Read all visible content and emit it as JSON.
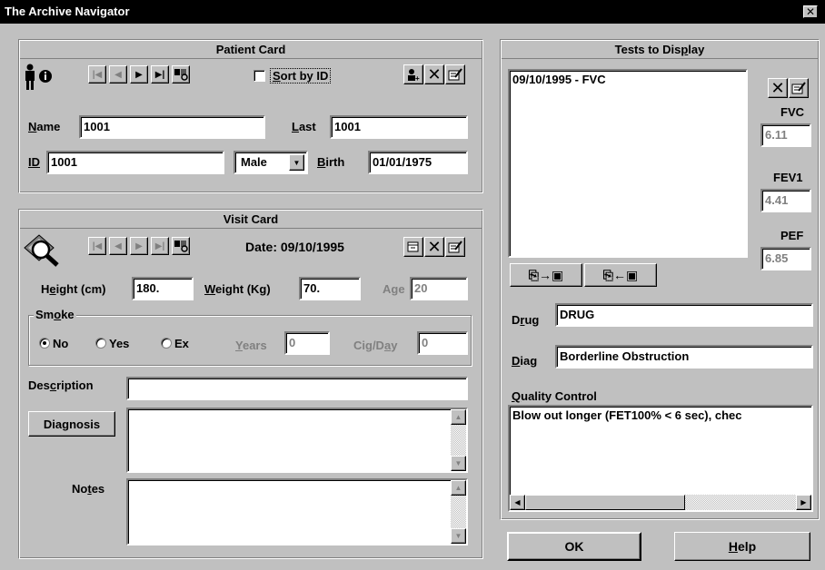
{
  "window": {
    "title": "The Archive Navigator",
    "close_glyph": "✕"
  },
  "patient": {
    "header": "Patient Card",
    "sort_by_id": {
      "label_pre": "",
      "hot": "S",
      "label_post": "ort by ID",
      "checked": false
    },
    "name": {
      "label_hot": "N",
      "label_rest": "ame",
      "value": "1001"
    },
    "last": {
      "label_hot": "L",
      "label_rest": "ast",
      "value": "1001"
    },
    "id": {
      "label_hot": "ID",
      "label_rest": "",
      "value": "1001"
    },
    "sex": {
      "value": "Male"
    },
    "birth": {
      "label_hot": "B",
      "label_rest": "irth",
      "value": "01/01/1975"
    }
  },
  "visit": {
    "header": "Visit Card",
    "date_label": "Date: 09/10/1995",
    "height": {
      "label_pre": "H",
      "hot": "e",
      "label_post": "ight (cm)",
      "value": "180."
    },
    "weight": {
      "label_pre": "",
      "hot": "W",
      "label_post": "eight (Kg)",
      "value": "70."
    },
    "age": {
      "label": "Age",
      "value": "20"
    },
    "smoke": {
      "title_pre": "Sm",
      "title_hot": "o",
      "title_post": "ke",
      "options": [
        "No",
        "Yes",
        "Ex"
      ],
      "selected": "No",
      "years": {
        "hot": "Y",
        "rest": "ears",
        "value": "0"
      },
      "cig_day": {
        "pre": "Cig/D",
        "hot": "a",
        "post": "y",
        "value": "0"
      }
    },
    "description": {
      "pre": "Des",
      "hot": "c",
      "post": "ription",
      "value": ""
    },
    "diagnosis_button": {
      "pre": "Dia",
      "hot": "g",
      "post": "nosis"
    },
    "diagnosis_value": "",
    "notes": {
      "pre": "No",
      "hot": "t",
      "post": "es",
      "value": ""
    }
  },
  "tests": {
    "header_pre": "Tests to Dis",
    "header_hot": "p",
    "header_post": "lay",
    "items": [
      "09/10/1995 - FVC"
    ],
    "metrics": [
      {
        "label": "FVC",
        "value": "6.11"
      },
      {
        "label": "FEV1",
        "value": "4.41"
      },
      {
        "label": "PEF",
        "value": "6.85"
      }
    ],
    "drug": {
      "pre": "D",
      "hot": "r",
      "post": "ug",
      "value": "DRUG"
    },
    "diag": {
      "pre": "",
      "hot": "D",
      "post": "iag",
      "value": "Borderline Obstruction"
    },
    "quality_control": {
      "hot": "Q",
      "rest": "uality Control",
      "value": "Blow out longer (FET100% < 6 sec), chec"
    }
  },
  "buttons": {
    "ok": "OK",
    "help_hot": "H",
    "help_rest": "elp"
  },
  "icons": {
    "first": "first-record-icon",
    "prev": "previous-record-icon",
    "next": "next-record-icon",
    "last": "last-record-icon",
    "search": "find-patient-icon",
    "add_patient": "add-patient-icon",
    "delete": "delete-icon",
    "edit": "edit-icon",
    "person": "person-info-icon",
    "visit": "magnifier-visit-icon",
    "export": "export-to-disk-icon",
    "import": "import-from-disk-icon"
  }
}
